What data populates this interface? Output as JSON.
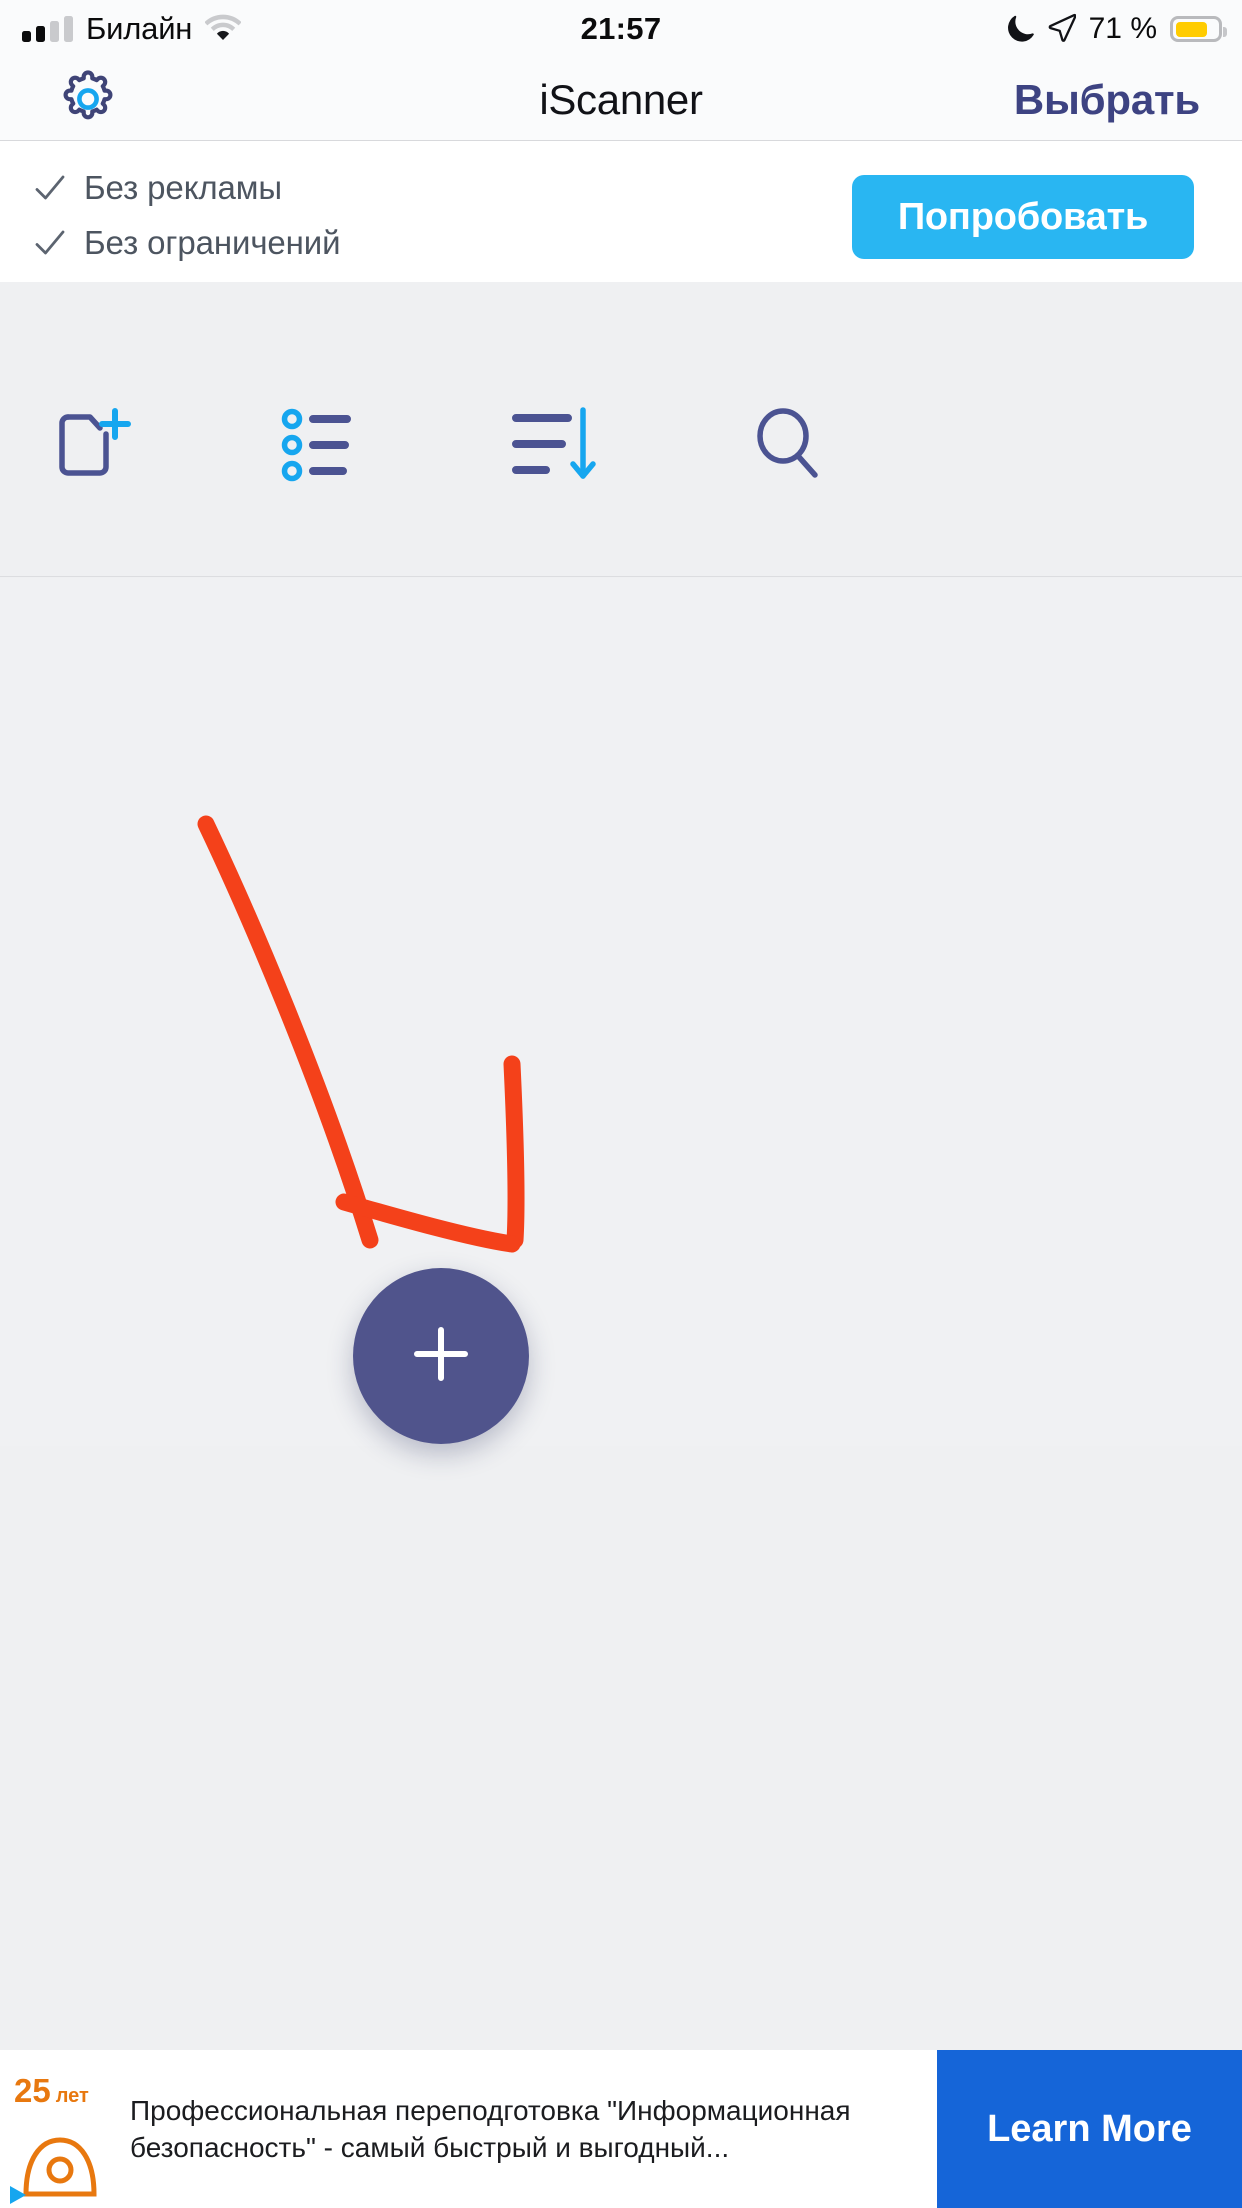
{
  "status_bar": {
    "carrier": "Билайн",
    "signal_bars_filled": 2,
    "signal_bars_total": 4,
    "wifi_icon": "wifi-icon",
    "time": "21:57",
    "dnd_icon": "moon-icon",
    "location_icon": "location-arrow-icon",
    "battery_percent": "71 %",
    "battery_level": 0.71,
    "battery_color": "#ffcc00"
  },
  "nav_bar": {
    "settings_icon": "gear-icon",
    "title": "iScanner",
    "select_label": "Выбрать",
    "select_color": "#3d4382"
  },
  "promo": {
    "features": [
      {
        "check_icon": "check-icon",
        "label": "Без рекламы"
      },
      {
        "check_icon": "check-icon",
        "label": "Без ограничений"
      }
    ],
    "try_button_label": "Попробовать",
    "try_button_color": "#29b6f2"
  },
  "toolbar": {
    "items": [
      {
        "name": "new-folder-icon",
        "label": "Новая папка"
      },
      {
        "name": "list-view-icon",
        "label": "Вид списка"
      },
      {
        "name": "sort-icon",
        "label": "Сортировка"
      },
      {
        "name": "search-icon",
        "label": "Поиск"
      }
    ],
    "icon_color": "#4b5392",
    "accent_color": "#16a6ef"
  },
  "document_list": {
    "items": [],
    "empty": true
  },
  "annotation": {
    "type": "hand-drawn-arrow",
    "color": "#f4411a",
    "points_to": "add-document-fab"
  },
  "fab": {
    "icon": "plus-icon",
    "color": "#50548c"
  },
  "ad_banner": {
    "logo_number": "25",
    "logo_suffix": "лет",
    "text": "Профессиональная переподготовка \"Информационная безопасность\" - самый быстрый и выгодный...",
    "cta_label": "Learn More",
    "cta_color": "#1565d8"
  }
}
